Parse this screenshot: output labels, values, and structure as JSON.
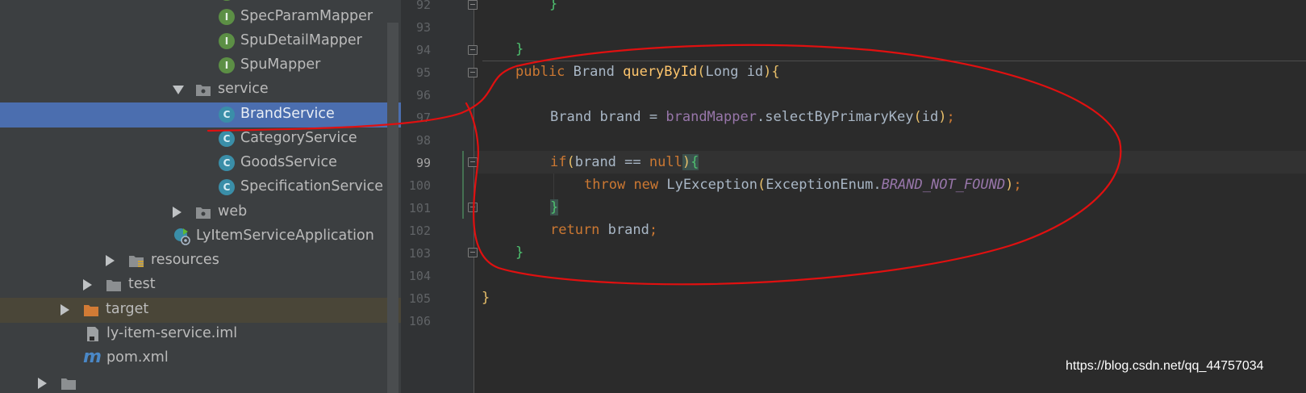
{
  "project_tree": {
    "items": [
      {
        "label": "SpecParamMapper",
        "kind": "interface",
        "icon": "interface-icon",
        "badge": "I"
      },
      {
        "label": "SpuDetailMapper",
        "kind": "interface",
        "icon": "interface-icon",
        "badge": "I"
      },
      {
        "label": "SpuMapper",
        "kind": "interface",
        "icon": "interface-icon",
        "badge": "I"
      },
      {
        "label": "service",
        "kind": "package",
        "icon": "package-folder-icon",
        "expanded": true
      },
      {
        "label": "BrandService",
        "kind": "class",
        "icon": "class-icon",
        "badge": "C",
        "selected": true
      },
      {
        "label": "CategoryService",
        "kind": "class",
        "icon": "class-icon",
        "badge": "C"
      },
      {
        "label": "GoodsService",
        "kind": "class",
        "icon": "class-icon",
        "badge": "C"
      },
      {
        "label": "SpecificationService",
        "kind": "class",
        "icon": "class-icon",
        "badge": "C"
      },
      {
        "label": "web",
        "kind": "package",
        "icon": "package-folder-icon",
        "expanded": false
      },
      {
        "label": "LyItemServiceApplication",
        "kind": "spring-boot-app",
        "icon": "spring-boot-app-icon"
      },
      {
        "label": "resources",
        "kind": "folder",
        "icon": "resources-folder-icon",
        "expanded": false
      },
      {
        "label": "test",
        "kind": "folder",
        "icon": "folder-icon",
        "expanded": false
      },
      {
        "label": "target",
        "kind": "excluded-folder",
        "icon": "excluded-folder-icon",
        "expanded": false
      },
      {
        "label": "ly-item-service.iml",
        "kind": "iml-file",
        "icon": "iml-file-icon"
      },
      {
        "label": "pom.xml",
        "kind": "maven-file",
        "icon": "maven-icon",
        "badge": "m"
      }
    ]
  },
  "editor": {
    "line_numbers": [
      "92",
      "93",
      "94",
      "95",
      "96",
      "97",
      "98",
      "99",
      "100",
      "101",
      "102",
      "103",
      "104",
      "105",
      "106"
    ],
    "current_line": "99",
    "lines": {
      "l92": {
        "close": "}"
      },
      "l94": {
        "close": "}"
      },
      "l95": {
        "mod": "public",
        "type": "Brand",
        "method": "queryById",
        "open_paren": "(",
        "param_type": "Long",
        "param": "id",
        "close_paren": ")",
        "brace": "{"
      },
      "l97": {
        "type": "Brand",
        "var": "brand",
        "eq": "=",
        "field": "brandMapper",
        "dot": ".",
        "call": "selectByPrimaryKey",
        "open_paren": "(",
        "arg": "id",
        "close_paren": ")",
        "semi": ";"
      },
      "l99": {
        "kw": "if",
        "open_paren": "(",
        "var": "brand",
        "op": "==",
        "null": "null",
        "close_paren": ")",
        "brace": "{"
      },
      "l100": {
        "kw_throw": "throw",
        "kw_new": "new",
        "cls": "LyException",
        "open_paren": "(",
        "enum_cls": "ExceptionEnum",
        "dot": ".",
        "constant": "BRAND_NOT_FOUND",
        "close_paren": ")",
        "semi": ";"
      },
      "l101": {
        "close": "}"
      },
      "l102": {
        "kw": "return",
        "var": "brand",
        "semi": ";"
      },
      "l103": {
        "close": "}"
      },
      "l105": {
        "close": "}"
      }
    }
  },
  "watermark": "https://blog.csdn.net/qq_44757034",
  "colors": {
    "annotation_marker": "#e01010",
    "selection": "#4b6eaf",
    "keyword": "#cc7832",
    "method": "#ffc66d",
    "field": "#9876aa"
  }
}
